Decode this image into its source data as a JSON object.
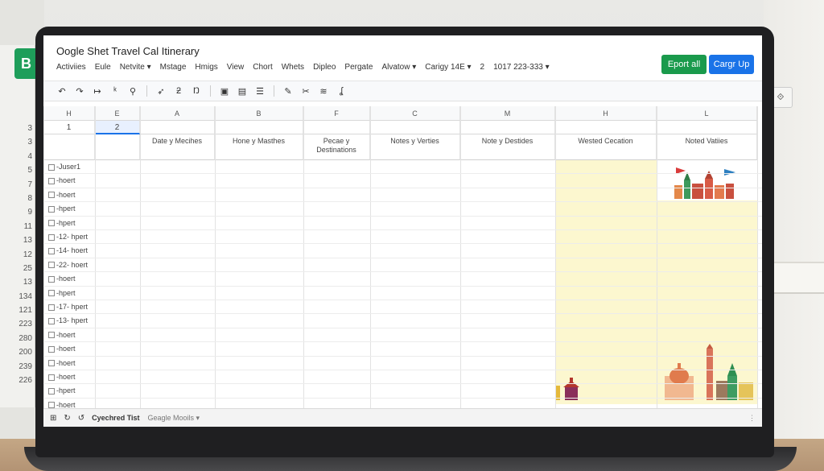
{
  "document": {
    "title": "Oogle Shet Travel Cal Itinerary",
    "menu": [
      "Activiies",
      "Eule",
      "Netvite ▾",
      "Mstage",
      "Hmigs",
      "View",
      "Chort",
      "Whets",
      "Dipleo",
      "Pergate",
      "Alvatow ▾",
      "Carigy 14E ▾",
      "2",
      "1017 223-333 ▾"
    ],
    "export_label": "Eport all",
    "signup_label": "Cargr Up"
  },
  "toolbar_icons": [
    "undo-icon",
    "redo-icon",
    "forward-icon",
    "back-icon",
    "paint-icon",
    "arrow-icon",
    "zoom-icon",
    "format-icon",
    "copy-icon",
    "doc-icon",
    "align-icon",
    "pen-icon",
    "cut-icon",
    "wave-icon",
    "function-icon"
  ],
  "toolbar_glyphs": [
    "↶",
    "↷",
    "↦",
    "ᵏ",
    "⚲",
    "➶",
    "ƻ",
    "Ŋ",
    "▣",
    "▤",
    "☰",
    "✎",
    "✂",
    "≋",
    "ʆ"
  ],
  "columns": {
    "letters": [
      "H",
      "E",
      "A",
      "B",
      "F",
      "C",
      "M",
      "H",
      "L"
    ],
    "sub": [
      "1",
      "2"
    ],
    "row_top_left": "3",
    "row_hdr_num": "7",
    "headers": [
      "",
      "",
      "Date y Mecihes",
      "Hone y Masthes",
      "Pecae y Destinations",
      "Notes y Verties",
      "Note y Destides",
      "Wested Cecation",
      "Noted Vatiies"
    ]
  },
  "rows": [
    {
      "num": "3",
      "label": "Juser1"
    },
    {
      "num": "4",
      "label": "hoert"
    },
    {
      "num": "5",
      "label": "hoert"
    },
    {
      "num": "7",
      "label": "hpert"
    },
    {
      "num": "8",
      "label": "hpert"
    },
    {
      "num": "9",
      "label": "12- hpert"
    },
    {
      "num": "11",
      "label": "14- hoert"
    },
    {
      "num": "13",
      "label": "22- hoert"
    },
    {
      "num": "12",
      "label": "hoert"
    },
    {
      "num": "25",
      "label": "hpert"
    },
    {
      "num": "13",
      "label": "17- hpert"
    },
    {
      "num": "134",
      "label": "13- hpert"
    },
    {
      "num": "121",
      "label": "hoert"
    },
    {
      "num": "223",
      "label": "hoert"
    },
    {
      "num": "280",
      "label": "hoert"
    },
    {
      "num": "200",
      "label": "hoert"
    },
    {
      "num": "239",
      "label": "hpert"
    },
    {
      "num": "226",
      "label": "hoert"
    }
  ],
  "footer": {
    "active_tab": "Cyechred Tist",
    "other_tab": "Geagle Mooils ▾",
    "right": "⋮"
  },
  "bg_window": {
    "logo": "B",
    "right_tab": "⟐"
  },
  "colors": {
    "export_green": "#1a9a4c",
    "signup_blue": "#1a73e8",
    "highlight_yellow": "#fcf7cf"
  }
}
